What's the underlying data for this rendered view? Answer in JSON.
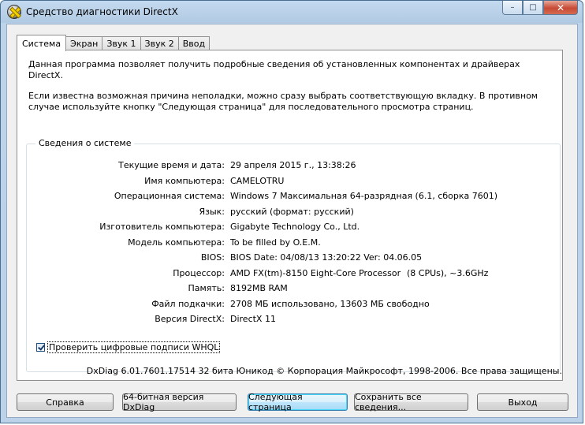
{
  "window": {
    "title": "Средство диагностики DirectX"
  },
  "caption": {
    "minimize": "–",
    "maximize": "□",
    "close": "✕"
  },
  "tabs": [
    "Система",
    "Экран",
    "Звук 1",
    "Звук 2",
    "Ввод"
  ],
  "intro": {
    "line1": "Данная программа позволяет получить подробные сведения об установленных компонентах и драйверах DirectX.",
    "line2": "Если известна возможная причина неполадки, можно сразу выбрать соответствующую вкладку. В противном случае используйте кнопку \"Следующая страница\" для последовательного просмотра страниц."
  },
  "system_info": {
    "title": "Сведения о системе",
    "rows": [
      {
        "label": "Текущие время и дата:",
        "value": "29 апреля 2015 г., 13:38:26"
      },
      {
        "label": "Имя компьютера:",
        "value": "CAMELOTRU"
      },
      {
        "label": "Операционная система:",
        "value": "Windows 7 Максимальная 64-разрядная (6.1, сборка 7601)"
      },
      {
        "label": "Язык:",
        "value": "русский (формат: русский)"
      },
      {
        "label": "Изготовитель компьютера:",
        "value": "Gigabyte Technology Co., Ltd."
      },
      {
        "label": "Модель компьютера:",
        "value": "To be filled by O.E.M."
      },
      {
        "label": "BIOS:",
        "value": "BIOS Date: 04/08/13 13:20:22 Ver: 04.06.05"
      },
      {
        "label": "Процессор:",
        "value": "AMD FX(tm)-8150 Eight-Core Processor",
        "extra": "(8 CPUs), ~3.6GHz"
      },
      {
        "label": "Память:",
        "value": "8192MB RAM"
      },
      {
        "label": "Файл подкачки:",
        "value": "2708 МБ использовано, 13603 МБ свободно"
      },
      {
        "label": "Версия DirectX:",
        "value": "DirectX 11"
      }
    ]
  },
  "whql": {
    "label": "Проверить цифровые подписи WHQL",
    "checked": true
  },
  "footer": "DxDiag 6.01.7601.17514 32 бита Юникод  © Корпорация Майкрософт, 1998-2006.  Все права защищены.",
  "buttons": {
    "help": "Справка",
    "dxdiag64": "64-битная версия DxDiag",
    "next_page": "Следующая страница",
    "save_all": "Сохранить все сведения...",
    "exit": "Выход"
  }
}
